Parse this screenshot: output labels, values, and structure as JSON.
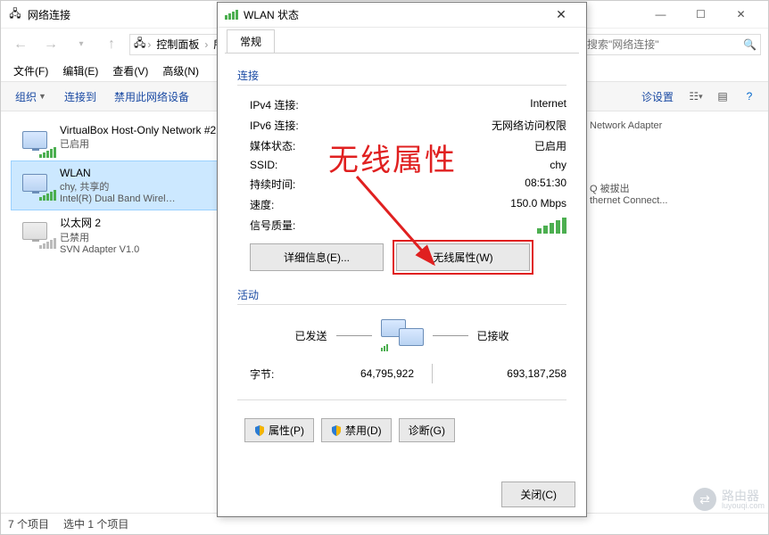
{
  "window": {
    "title": "网络连接",
    "nav_back": "←",
    "nav_fwd": "→",
    "nav_up": "↑",
    "breadcrumb": [
      "控制面板",
      "所有"
    ],
    "search_placeholder": "搜索\"网络连接\"",
    "menus": [
      "文件(F)",
      "编辑(E)",
      "查看(V)",
      "高级(N)"
    ],
    "toolbar": {
      "organize": "组织",
      "connect": "连接到",
      "disable": "禁用此网络设备",
      "diag": "诊设置"
    },
    "min": "—",
    "max": "☐",
    "close": "✕"
  },
  "connections": [
    {
      "name": "VirtualBox Host-Only Network #2",
      "status": "已启用",
      "adapter": "",
      "right": "Network Adapter"
    },
    {
      "name": "WLAN",
      "status": "chy, 共享的",
      "adapter": "Intel(R) Dual Band Wirel…",
      "right": "Q 被拔出\nthernet Connect...",
      "selected": true
    },
    {
      "name": "以太网 2",
      "status": "已禁用",
      "adapter": "SVN Adapter V1.0",
      "right": "",
      "disabled": true
    }
  ],
  "statusbar": {
    "items": "7 个项目",
    "selected": "选中 1 个项目"
  },
  "dialog": {
    "title": "WLAN 状态",
    "tab": "常规",
    "group_conn": "连接",
    "rows": {
      "ipv4_k": "IPv4 连接:",
      "ipv4_v": "Internet",
      "ipv6_k": "IPv6 连接:",
      "ipv6_v": "无网络访问权限",
      "media_k": "媒体状态:",
      "media_v": "已启用",
      "ssid_k": "SSID:",
      "ssid_v": "chy",
      "dur_k": "持续时间:",
      "dur_v": "08:51:30",
      "speed_k": "速度:",
      "speed_v": "150.0 Mbps",
      "sig_k": "信号质量:"
    },
    "btn_details": "详细信息(E)...",
    "btn_wireless": "无线属性(W)",
    "group_activity": "活动",
    "activity": {
      "sent": "已发送",
      "recv": "已接收",
      "bytes_label": "字节:",
      "bytes_sent": "64,795,922",
      "bytes_recv": "693,187,258"
    },
    "btn_props": "属性(P)",
    "btn_disable": "禁用(D)",
    "btn_diag": "诊断(G)",
    "btn_close": "关闭(C)"
  },
  "annotation": {
    "label": "无线属性"
  },
  "watermark": {
    "name": "路由器",
    "domain": "luyouqi.com"
  }
}
